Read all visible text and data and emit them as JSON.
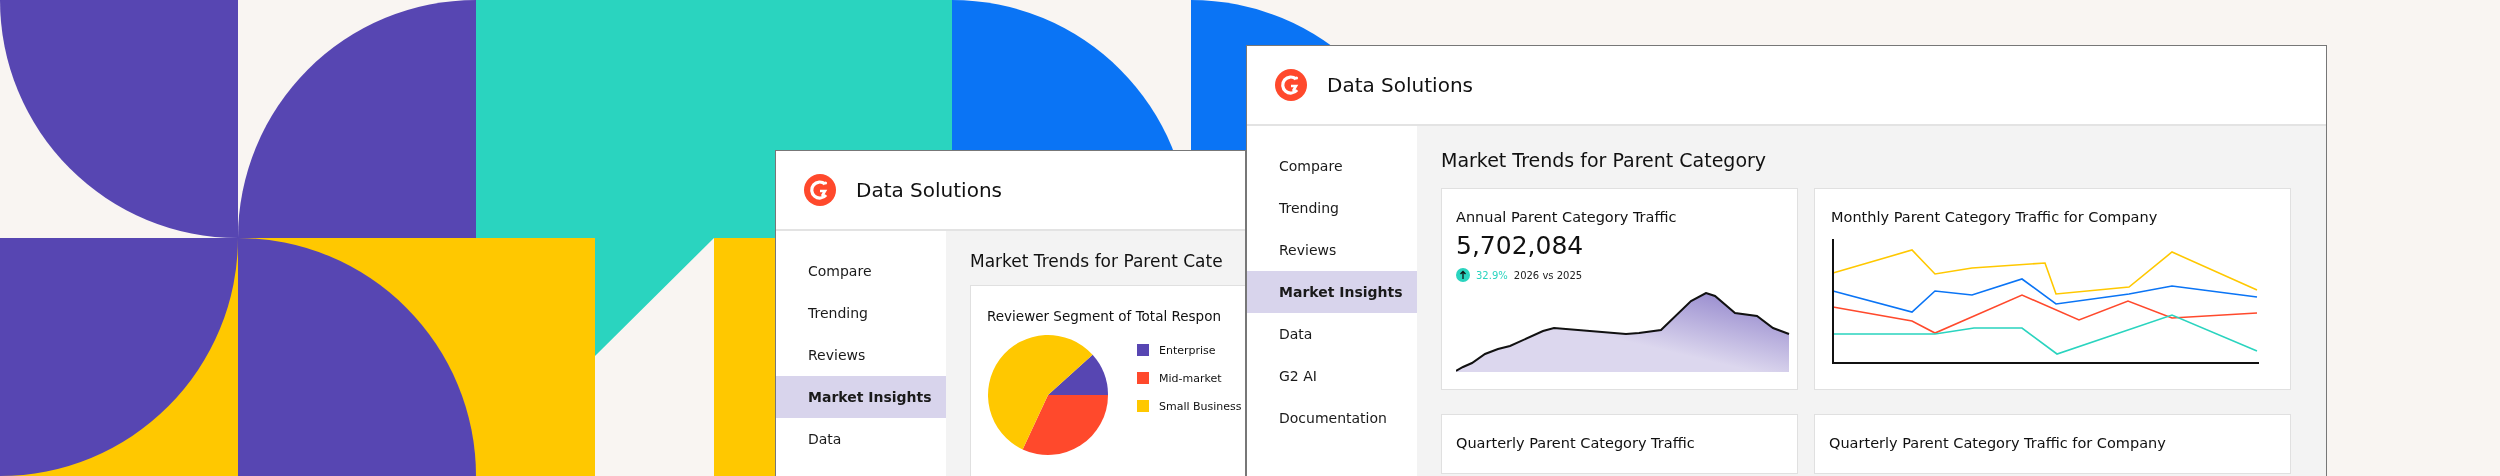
{
  "windows": [
    {
      "title": "Data Solutions",
      "nav": [
        {
          "label": "Compare",
          "selected": false
        },
        {
          "label": "Trending",
          "selected": false
        },
        {
          "label": "Reviews",
          "selected": false
        },
        {
          "label": "Market Insights",
          "selected": true
        },
        {
          "label": "Data",
          "selected": false
        }
      ],
      "heading": "Market Trends for Parent Cate",
      "cards": [
        {
          "kind": "pie",
          "title": "Reviewer Segment of Total Respon",
          "legend": [
            {
              "label": "Enterprise",
              "color": "#5746b2"
            },
            {
              "label": "Mid-market",
              "color": "#ff492c"
            },
            {
              "label": "Small Business",
              "color": "#ffc800"
            }
          ]
        }
      ]
    },
    {
      "title": "Data Solutions",
      "nav": [
        {
          "label": "Compare",
          "selected": false
        },
        {
          "label": "Trending",
          "selected": false
        },
        {
          "label": "Reviews",
          "selected": false
        },
        {
          "label": "Market Insights",
          "selected": true
        },
        {
          "label": "Data",
          "selected": false
        },
        {
          "label": "G2 AI",
          "selected": false
        },
        {
          "label": "Documentation",
          "selected": false
        }
      ],
      "heading": "Market Trends for Parent Category",
      "cards": [
        {
          "kind": "area",
          "title": "Annual Parent Category Traffic",
          "value": "5,702,084",
          "change": "32.9%",
          "comparison": "2026 vs 2025"
        },
        {
          "kind": "lines",
          "title": "Monthly Parent Category Traffic for Company"
        },
        {
          "kind": "heading",
          "title": "Quarterly Parent Category Traffic"
        },
        {
          "kind": "heading",
          "title": "Quarterly Parent Category Traffic for Company"
        }
      ]
    }
  ]
}
